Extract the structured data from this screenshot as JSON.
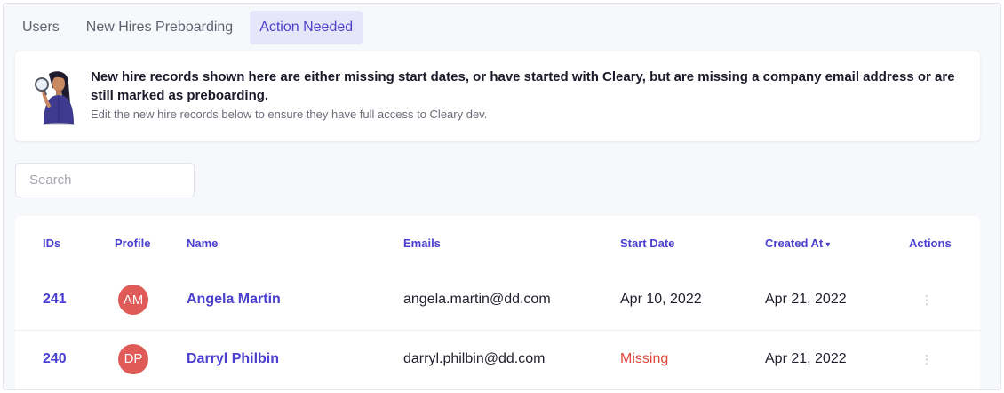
{
  "tabs": [
    {
      "label": "Users",
      "active": false
    },
    {
      "label": "New Hires Preboarding",
      "active": false
    },
    {
      "label": "Action Needed",
      "active": true
    }
  ],
  "banner": {
    "illustration": "woman-with-magnifier-illustration",
    "title": "New hire records shown here are either missing start dates, or have started with Cleary, but are missing a company email address or are still marked as preboarding.",
    "subtitle": "Edit the new hire records below to ensure they have full access to Cleary dev."
  },
  "search": {
    "placeholder": "Search",
    "value": ""
  },
  "table": {
    "headers": {
      "ids": "IDs",
      "profile": "Profile",
      "name": "Name",
      "emails": "Emails",
      "start_date": "Start Date",
      "created_at": "Created At",
      "created_at_sort": "▾",
      "actions": "Actions"
    },
    "rows": [
      {
        "id": "241",
        "initials": "AM",
        "name": "Angela Martin",
        "email": "angela.martin@dd.com",
        "start_date": "Apr 10, 2022",
        "created_at": "Apr 21, 2022",
        "actions_icon": "⋮"
      },
      {
        "id": "240",
        "initials": "DP",
        "name": "Darryl Philbin",
        "email": "darryl.philbin@dd.com",
        "start_date": "Missing",
        "created_at": "Apr 21, 2022",
        "actions_icon": "⋮"
      }
    ]
  },
  "colors": {
    "accent": "#4b3fd0",
    "active_tab_bg": "#e6e6fb",
    "avatar_bg": "#e05a57",
    "missing": "#e2483d",
    "page_bg": "#f7f8fc"
  }
}
